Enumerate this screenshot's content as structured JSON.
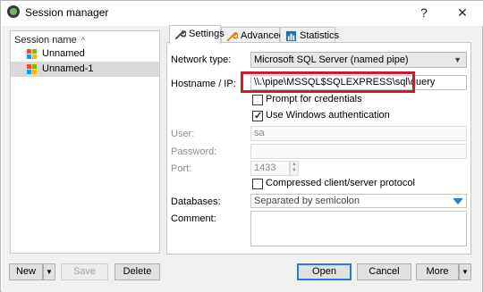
{
  "window": {
    "title": "Session manager",
    "help_glyph": "?",
    "close_glyph": "✕"
  },
  "sessions": {
    "header": "Session name",
    "sort_glyph": "^",
    "items": [
      {
        "label": "Unnamed",
        "selected": false
      },
      {
        "label": "Unnamed-1",
        "selected": true
      }
    ]
  },
  "tabs": [
    {
      "label": "Settings",
      "icon": "wrench-icon",
      "active": true
    },
    {
      "label": "Advanced",
      "icon": "orange-wrench-icon",
      "active": false
    },
    {
      "label": "Statistics",
      "icon": "bar-chart-icon",
      "active": false
    }
  ],
  "settings": {
    "network_type_label": "Network type:",
    "network_type_value": "Microsoft SQL Server (named pipe)",
    "hostname_label": "Hostname / IP:",
    "hostname_value": "\\\\.\\pipe\\MSSQL$SQLEXPRESS\\sql\\query",
    "prompt_credentials_label": "Prompt for credentials",
    "prompt_credentials_checked": false,
    "windows_auth_label": "Use Windows authentication",
    "windows_auth_checked": true,
    "user_label": "User:",
    "user_value": "sa",
    "password_label": "Password:",
    "password_value": "",
    "port_label": "Port:",
    "port_value": "1433",
    "compressed_label": "Compressed client/server protocol",
    "compressed_checked": false,
    "databases_label": "Databases:",
    "databases_value": "Separated by semicolon",
    "comment_label": "Comment:",
    "comment_value": ""
  },
  "buttons": {
    "new": "New",
    "save": "Save",
    "delete": "Delete",
    "open": "Open",
    "cancel": "Cancel",
    "more": "More"
  },
  "colors": {
    "highlight_box": "#d0192b",
    "accent": "#2b79d1"
  }
}
